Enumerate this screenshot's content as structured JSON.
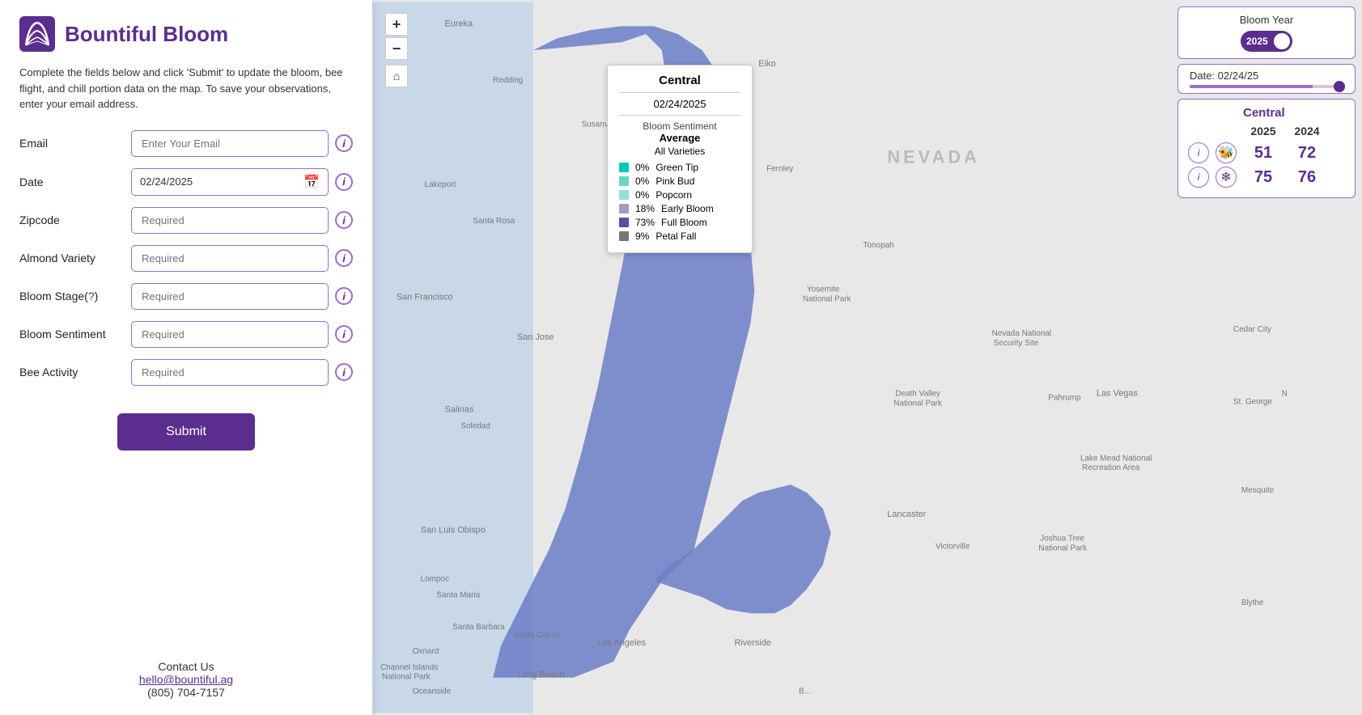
{
  "app": {
    "name": "Bountiful Bloom",
    "description": "Complete the fields below and click 'Submit' to update the bloom, bee flight, and chill portion data on the map. To save your observations, enter your email address."
  },
  "form": {
    "email_label": "Email",
    "email_placeholder": "Enter Your Email",
    "date_label": "Date",
    "date_value": "02/24/2025",
    "zipcode_label": "Zipcode",
    "zipcode_placeholder": "Required",
    "almond_variety_label": "Almond Variety",
    "almond_variety_placeholder": "Required",
    "bloom_stage_label": "Bloom Stage(",
    "bloom_stage_q": "?",
    "bloom_stage_end": ")",
    "bloom_stage_placeholder": "Required",
    "bloom_sentiment_label": "Bloom Sentiment",
    "bloom_sentiment_placeholder": "Required",
    "bee_activity_label": "Bee Activity",
    "bee_activity_placeholder": "Required",
    "submit_label": "Submit"
  },
  "contact": {
    "label": "Contact Us",
    "email": "hello@bountiful.ag",
    "phone": "(805) 704-7157"
  },
  "map_popup": {
    "title": "Central",
    "date": "02/24/2025",
    "sentiment_label": "Bloom Sentiment",
    "average_label": "Average",
    "varieties_label": "All Varieties",
    "legend": [
      {
        "color": "#00c9b1",
        "pct": "0%",
        "label": "Green Tip"
      },
      {
        "color": "#66d4c8",
        "pct": "0%",
        "label": "Pink Bud"
      },
      {
        "color": "#99ddd8",
        "pct": "0%",
        "label": "Popcorn"
      },
      {
        "color": "#9e9ec8",
        "pct": "18%",
        "label": "Early Bloom"
      },
      {
        "color": "#5b4fa0",
        "pct": "73%",
        "label": "Full Bloom"
      },
      {
        "color": "#777777",
        "pct": "9%",
        "label": "Petal Fall"
      }
    ]
  },
  "bloom_year_box": {
    "title": "Bloom Year",
    "year": "2025"
  },
  "date_box": {
    "label": "Date: 02/24/25"
  },
  "stats": {
    "region": "Central",
    "year_2025": "2025",
    "year_2024": "2024",
    "bee_2025": "51",
    "bee_2024": "72",
    "chill_2025": "75",
    "chill_2024": "76"
  },
  "zoom": {
    "plus": "+",
    "minus": "−",
    "home": "⌂"
  }
}
